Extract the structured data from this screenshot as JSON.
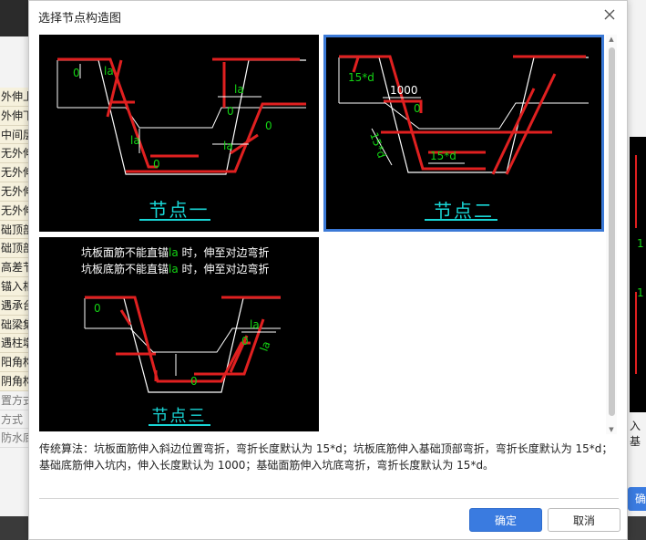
{
  "background": {
    "left_items": [
      "外伸上",
      "外伸下",
      "中间层",
      "无外伸",
      "无外伸",
      "无外伸",
      "无外伸",
      "础顶部",
      "础顶部",
      "高差节",
      "锚入相",
      "遇承台",
      "础梁集",
      "遇柱墩",
      "阳角构",
      "阴角构",
      "置方式",
      "方式",
      "防水底"
    ],
    "right_text": "入基",
    "right_button": "确",
    "right_cad_labels": [
      "1",
      "1"
    ]
  },
  "dialog": {
    "title": "选择节点构造图",
    "nodes": [
      {
        "label": "节点一",
        "annotations": {
          "la_slope": "la",
          "la_side": "la",
          "la_inner": "la",
          "la_bottom": "la",
          "zero_a": "0",
          "zero_b": "0",
          "zero_c": "0",
          "zero_d": "0"
        }
      },
      {
        "label": "节点二",
        "selected": true,
        "annotations": {
          "fifteen_d_top": "15*d",
          "len_1000": "1000",
          "fifteen_d_slope": "15*d",
          "fifteen_d_inner": "15*d",
          "zero_a": "0"
        }
      },
      {
        "label": "节点三",
        "note_line1": {
          "prefix": "坑板面筋不能直锚",
          "la": "la",
          "suffix": " 时，伸至对边弯折"
        },
        "note_line2": {
          "prefix": "坑板底筋不能直锚",
          "la": "la",
          "suffix": " 时，伸至对边弯折"
        },
        "annotations": {
          "la_top": "la",
          "la_right": "la",
          "zero_a": "0",
          "zero_b": "0",
          "zero_c": "0"
        }
      }
    ],
    "description": "传统算法：坑板面筋伸入斜边位置弯折，弯折长度默认为 15*d；坑板底筋伸入基础顶部弯折，弯折长度默认为 15*d；基础底筋伸入坑内，伸入长度默认为 1000；基础面筋伸入坑底弯折，弯折长度默认为 15*d。",
    "ok_label": "确定",
    "cancel_label": "取消"
  },
  "colors": {
    "accent": "#3a7be0",
    "node_label": "#19d6d6",
    "rebar": "#e02020",
    "dim_text": "#14d414",
    "selection_border": "#3b79d6"
  }
}
